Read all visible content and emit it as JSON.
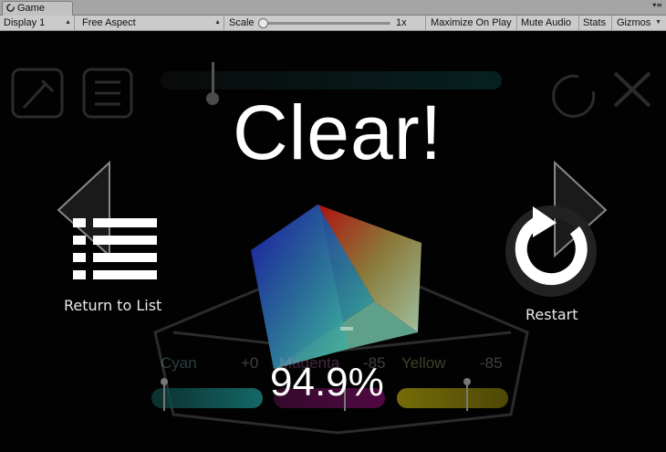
{
  "window": {
    "tab_title": "Game"
  },
  "toolbar": {
    "display": "Display 1",
    "aspect": "Free Aspect",
    "scale_label": "Scale",
    "scale_value": "1x",
    "maximize_on_play": "Maximize On Play",
    "mute_audio": "Mute Audio",
    "stats": "Stats",
    "gizmos": "Gizmos"
  },
  "game": {
    "title": "Clear!",
    "return_label": "Return to List",
    "restart_label": "Restart",
    "score": "94.9%",
    "sliders": [
      {
        "name": "Cyan",
        "value": "+0",
        "color": "#1aa6a6"
      },
      {
        "name": "Magenta",
        "value": "-85",
        "color": "#b01a9a"
      },
      {
        "name": "Yellow",
        "value": "-85",
        "color": "#a8a21a"
      }
    ]
  },
  "icons": [
    "unity-icon",
    "dropper-icon",
    "list-icon",
    "reload-icon",
    "close-icon",
    "arrow-left-icon",
    "arrow-right-icon",
    "restart-icon"
  ]
}
